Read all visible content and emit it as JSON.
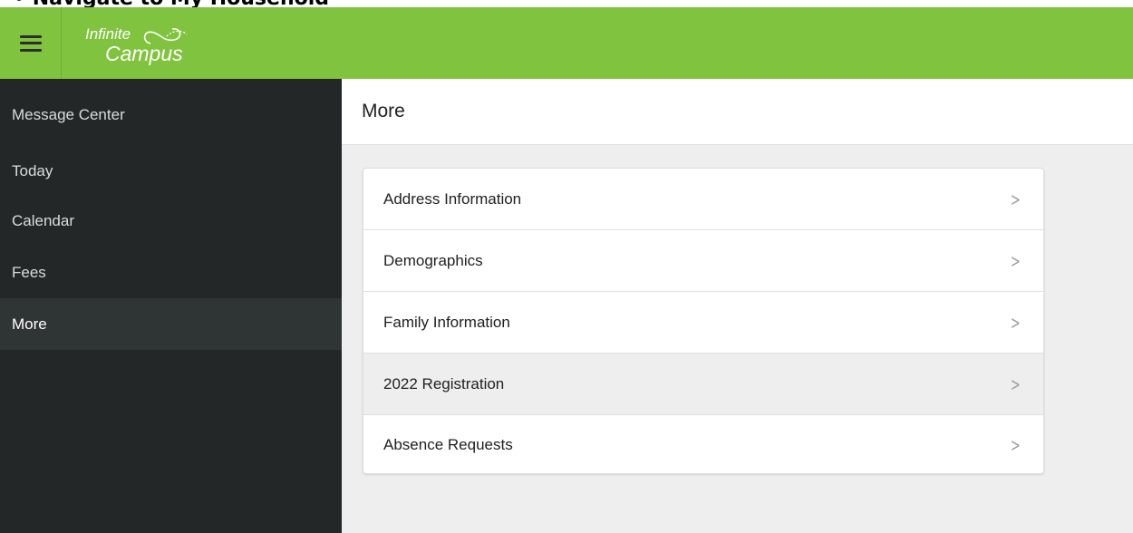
{
  "page_heading_clipped": "• Navigate to My Household",
  "app": {
    "menu_icon": "hamburger-icon",
    "logo_line1": "Infinite",
    "logo_line2": "Campus",
    "brand_color": "#80c33f"
  },
  "sidebar": {
    "items": [
      {
        "label": "Message Center",
        "active": false
      },
      {
        "label": "Today",
        "active": false
      },
      {
        "label": "Calendar",
        "active": false
      },
      {
        "label": "Fees",
        "active": false
      },
      {
        "label": "More",
        "active": true
      }
    ]
  },
  "main": {
    "title": "More",
    "list": [
      {
        "label": "Address Information",
        "icon": "chevron-right-icon"
      },
      {
        "label": "Demographics",
        "icon": "chevron-right-icon"
      },
      {
        "label": "Family Information",
        "icon": "chevron-right-icon"
      },
      {
        "label": "2022 Registration",
        "icon": "chevron-right-icon",
        "highlighted": true
      },
      {
        "label": "Absence Requests",
        "icon": "chevron-right-icon"
      }
    ]
  }
}
